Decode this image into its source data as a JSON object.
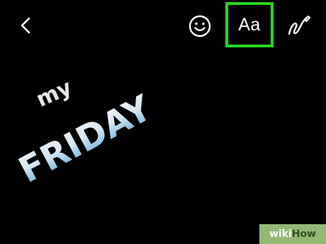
{
  "toolbar": {
    "back_icon": "chevron-left-icon",
    "emoji_icon": "smiley-face-icon",
    "text_label": "Aa",
    "draw_icon": "pen-squiggle-icon",
    "highlight_color": "#27d61f"
  },
  "sticker": {
    "line1": "my",
    "line2": "FRIDAY"
  },
  "watermark": {
    "part1": "wiki",
    "part2": "How"
  }
}
